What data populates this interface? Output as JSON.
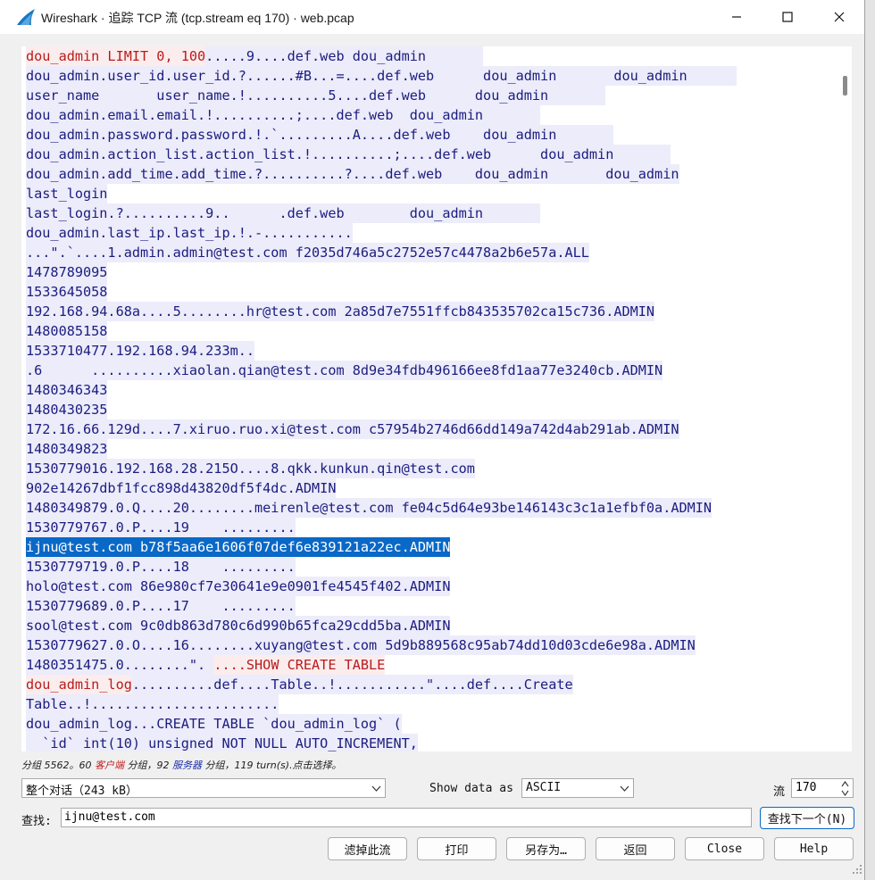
{
  "window": {
    "title": "Wireshark · 追踪 TCP 流 (tcp.stream eq 170) · web.pcap"
  },
  "colors": {
    "client_bg": "#fbeded",
    "client_fg": "#b81c1c",
    "server_bg": "#ececfa",
    "server_fg": "#1c1c80",
    "selection": "#0a68c6"
  },
  "stream": {
    "lines": [
      [
        {
          "t": "dou_admin LIMIT 0, 100",
          "c": "cl"
        },
        {
          "t": ".....9....def.web dou_admin       ",
          "c": "sv"
        }
      ],
      [
        {
          "t": "dou_admin.user_id.user_id.?......#B...=....def.web      dou_admin       dou_admin      ",
          "c": "sv"
        }
      ],
      [
        {
          "t": "user_name       user_name.!..........5....def.web      dou_admin       ",
          "c": "sv"
        }
      ],
      [
        {
          "t": "dou_admin.email.email.!..........;....def.web  dou_admin       ",
          "c": "sv"
        }
      ],
      [
        {
          "t": "dou_admin.password.password.!.`.........A....def.web    dou_admin       ",
          "c": "sv"
        }
      ],
      [
        {
          "t": "dou_admin.action_list.action_list.!..........;....def.web      dou_admin       ",
          "c": "sv"
        }
      ],
      [
        {
          "t": "dou_admin.add_time.add_time.?..........?....def.web    dou_admin       dou_admin",
          "c": "sv"
        }
      ],
      [
        {
          "t": "last_login",
          "c": "sv"
        }
      ],
      [
        {
          "t": "last_login.?..........9..      .def.web        dou_admin       ",
          "c": "sv"
        }
      ],
      [
        {
          "t": "dou_admin.last_ip.last_ip.!.-...........",
          "c": "sv"
        }
      ],
      [
        {
          "t": "...\".`....1.admin.admin@test.com f2035d746a5c2752e57c4478a2b6e57a.ALL",
          "c": "sv"
        }
      ],
      [
        {
          "t": "1478789095",
          "c": "sv"
        }
      ],
      [
        {
          "t": "1533645058",
          "c": "sv"
        }
      ],
      [
        {
          "t": "192.168.94.68a....5........hr@test.com 2a85d7e7551ffcb843535702ca15c736.ADMIN",
          "c": "sv"
        }
      ],
      [
        {
          "t": "1480085158",
          "c": "sv"
        }
      ],
      [
        {
          "t": "1533710477.192.168.94.233m..",
          "c": "sv"
        }
      ],
      [
        {
          "t": ".6      ..........xiaolan.qian@test.com 8d9e34fdb496166ee8fd1aa77e3240cb.ADMIN",
          "c": "sv"
        }
      ],
      [
        {
          "t": "1480346343",
          "c": "sv"
        }
      ],
      [
        {
          "t": "1480430235",
          "c": "sv"
        }
      ],
      [
        {
          "t": "172.16.66.129d....7.xiruo.ruo.xi@test.com c57954b2746d66dd149a742d4ab291ab.ADMIN",
          "c": "sv"
        }
      ],
      [
        {
          "t": "1480349823",
          "c": "sv"
        }
      ],
      [
        {
          "t": "1530779016.192.168.28.215O....8.qkk.kunkun.qin@test.com",
          "c": "sv"
        }
      ],
      [
        {
          "t": "902e14267dbf1fcc898d43820df5f4dc.ADMIN",
          "c": "sv"
        }
      ],
      [
        {
          "t": "1480349879.0.Q....20........meirenle@test.com fe04c5d64e93be146143c3c1a1efbf0a.ADMIN",
          "c": "sv"
        }
      ],
      [
        {
          "t": "1530779767.0.P....19    .........",
          "c": "sv"
        }
      ],
      [
        {
          "t": "ijnu@test.com b78f5aa6e1606f07def6e839121a22ec.ADMIN",
          "c": "hl"
        }
      ],
      [
        {
          "t": "1530779719.0.P....18    .........",
          "c": "sv"
        }
      ],
      [
        {
          "t": "holo@test.com 86e980cf7e30641e9e0901fe4545f402.ADMIN",
          "c": "sv"
        }
      ],
      [
        {
          "t": "1530779689.0.P....17    .........",
          "c": "sv"
        }
      ],
      [
        {
          "t": "sool@test.com 9c0db863d780c6d990b65fca29cdd5ba.ADMIN",
          "c": "sv"
        }
      ],
      [
        {
          "t": "1530779627.0.O....16........xuyang@test.com 5d9b889568c95ab74dd10d03cde6e98a.ADMIN",
          "c": "sv"
        }
      ],
      [
        {
          "t": "1480351475.0........\". ",
          "c": "sv"
        },
        {
          "t": "....SHOW CREATE TABLE",
          "c": "cl"
        }
      ],
      [
        {
          "t": "dou_admin_log",
          "c": "cl"
        },
        {
          "t": "..........def....Table..!...........\"....def....Create",
          "c": "sv"
        }
      ],
      [
        {
          "t": "Table..!.......................",
          "c": "sv"
        }
      ],
      [
        {
          "t": "dou_admin_log...CREATE TABLE `dou_admin_log` (",
          "c": "sv"
        }
      ],
      [
        {
          "t": "  `id` int(10) unsigned NOT NULL AUTO_INCREMENT,",
          "c": "sv"
        }
      ]
    ]
  },
  "status": {
    "prefix": "分组 5562。60 ",
    "client": "客户端",
    "mid": " 分组，92 ",
    "server": "服务器",
    "suffix": " 分组，119 turn(s).点击选择。"
  },
  "controls": {
    "conversation_select": "整个对话（243 kB）",
    "show_data_label": "Show data as",
    "show_data_value": "ASCII",
    "stream_label": "流",
    "stream_value": "170",
    "find_label": "查找:",
    "find_value": "ijnu@test.com",
    "find_next": "查找下一个(N)"
  },
  "buttons": {
    "filter_out": "滤掉此流",
    "print": "打印",
    "save_as": "另存为…",
    "back": "返回",
    "close": "Close",
    "help": "Help"
  }
}
